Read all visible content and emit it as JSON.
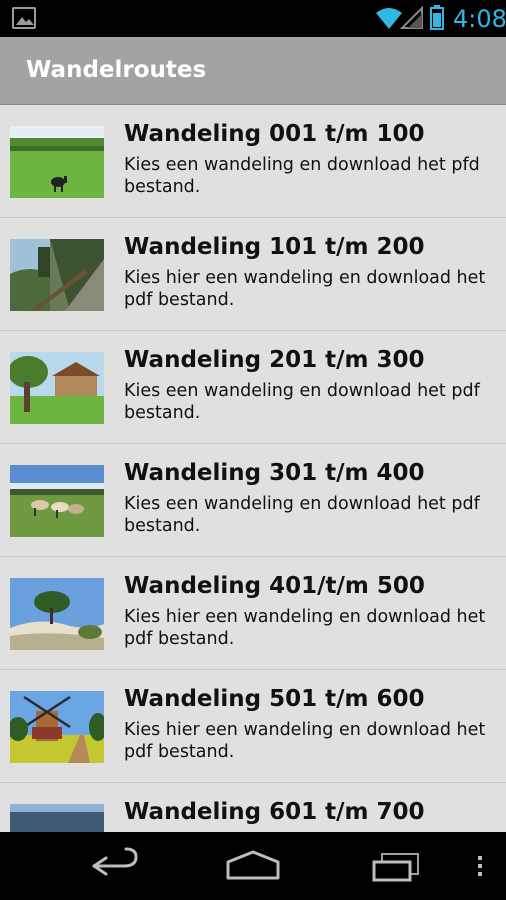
{
  "status_bar": {
    "time": "4:08",
    "accent": "#33b5e5",
    "icons": [
      "image-notification-icon",
      "wifi-icon",
      "signal-icon",
      "battery-icon"
    ]
  },
  "action_bar": {
    "title": "Wandelroutes"
  },
  "routes": [
    {
      "title": "Wandeling 001 t/m 100",
      "description": "Kies een wandeling  en download het pfd bestand."
    },
    {
      "title": "Wandeling 101 t/m 200",
      "description": "Kies hier  een wandeling en download het pdf bestand."
    },
    {
      "title": "Wandeling 201 t/m 300",
      "description": "Kies een wandeling en download het pdf bestand."
    },
    {
      "title": "Wandeling 301 t/m 400",
      "description": "Kies een wandeling en download het pdf bestand."
    },
    {
      "title": "Wandeling 401/t/m 500",
      "description": "Kies hier een wandeling en download het pdf bestand."
    },
    {
      "title": "Wandeling 501 t/m 600",
      "description": "Kies hier een wandeling en download het pdf bestand."
    },
    {
      "title": "Wandeling 601 t/m 700",
      "description": ""
    }
  ],
  "nav_bar": {
    "icons": [
      "back-icon",
      "home-icon",
      "recent-apps-icon",
      "menu-icon"
    ]
  }
}
